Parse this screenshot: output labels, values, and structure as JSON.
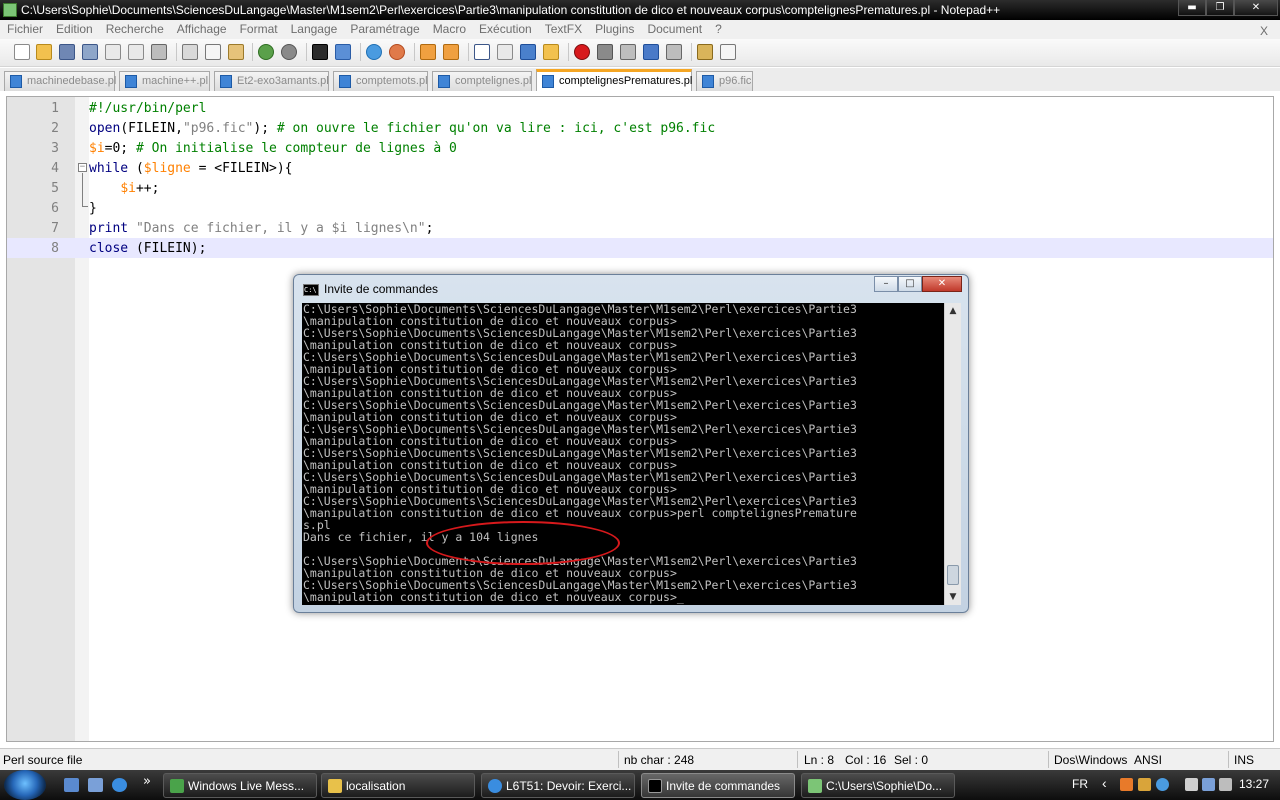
{
  "window": {
    "title": "C:\\Users\\Sophie\\Documents\\SciencesDuLangage\\Master\\M1sem2\\Perl\\exercices\\Partie3\\manipulation constitution de dico et nouveaux corpus\\comptelignesPrematures.pl - Notepad++",
    "minimize": "▬",
    "maximize": "❐",
    "close": "✕"
  },
  "menu": {
    "items": [
      "Fichier",
      "Edition",
      "Recherche",
      "Affichage",
      "Format",
      "Langage",
      "Paramétrage",
      "Macro",
      "Exécution",
      "TextFX",
      "Plugins",
      "Document",
      "?"
    ],
    "close": "X"
  },
  "tabs": [
    {
      "label": "machinedebase.pl"
    },
    {
      "label": "machine++.pl"
    },
    {
      "label": "Et2-exo3amants.pl"
    },
    {
      "label": "comptemots.pl"
    },
    {
      "label": "comptelignes.pl"
    },
    {
      "label": "comptelignesPrematures.pl",
      "active": true
    },
    {
      "label": "p96.fic"
    }
  ],
  "editor": {
    "line_numbers": [
      "1",
      "2",
      "3",
      "4",
      "5",
      "6",
      "7",
      "8"
    ],
    "code": {
      "l1": "#!/usr/bin/perl",
      "l2_fn": "open",
      "l2_args_pre": "(FILEIN,",
      "l2_str": "\"p96.fic\"",
      "l2_args_post": ");",
      "l2_comment": " # on ouvre le fichier qu'on va lire : ici, c'est p96.fic",
      "l3_var": "$i",
      "l3_rest": "=0;",
      "l3_comment": " # On initialise le compteur de lignes à 0",
      "l4_kw": "while",
      "l4_pre": " (",
      "l4_var": "$ligne",
      "l4_post": " = <FILEIN>){",
      "l5_indent": "    ",
      "l5_var": "$i",
      "l5_rest": "++;",
      "l6": "}",
      "l7_kw": "print",
      "l7_str": " \"Dans ce fichier, il y a $i lignes\\n\"",
      "l7_post": ";",
      "l8_kw": "close",
      "l8_rest": " (FILEIN);"
    },
    "fold_marker": "−"
  },
  "cmd": {
    "title": "Invite de commandes",
    "icon_text": "C:\\",
    "minimize": "–",
    "maximize": "□",
    "close": "✕",
    "scroll_up": "▲",
    "scroll_down": "▼",
    "lines": [
      "C:\\Users\\Sophie\\Documents\\SciencesDuLangage\\Master\\M1sem2\\Perl\\exercices\\Partie3",
      "\\manipulation constitution de dico et nouveaux corpus>",
      "C:\\Users\\Sophie\\Documents\\SciencesDuLangage\\Master\\M1sem2\\Perl\\exercices\\Partie3",
      "\\manipulation constitution de dico et nouveaux corpus>",
      "C:\\Users\\Sophie\\Documents\\SciencesDuLangage\\Master\\M1sem2\\Perl\\exercices\\Partie3",
      "\\manipulation constitution de dico et nouveaux corpus>",
      "C:\\Users\\Sophie\\Documents\\SciencesDuLangage\\Master\\M1sem2\\Perl\\exercices\\Partie3",
      "\\manipulation constitution de dico et nouveaux corpus>",
      "C:\\Users\\Sophie\\Documents\\SciencesDuLangage\\Master\\M1sem2\\Perl\\exercices\\Partie3",
      "\\manipulation constitution de dico et nouveaux corpus>",
      "C:\\Users\\Sophie\\Documents\\SciencesDuLangage\\Master\\M1sem2\\Perl\\exercices\\Partie3",
      "\\manipulation constitution de dico et nouveaux corpus>",
      "C:\\Users\\Sophie\\Documents\\SciencesDuLangage\\Master\\M1sem2\\Perl\\exercices\\Partie3",
      "\\manipulation constitution de dico et nouveaux corpus>",
      "C:\\Users\\Sophie\\Documents\\SciencesDuLangage\\Master\\M1sem2\\Perl\\exercices\\Partie3",
      "\\manipulation constitution de dico et nouveaux corpus>",
      "C:\\Users\\Sophie\\Documents\\SciencesDuLangage\\Master\\M1sem2\\Perl\\exercices\\Partie3",
      "\\manipulation constitution de dico et nouveaux corpus>perl comptelignesPremature",
      "s.pl",
      "Dans ce fichier, il y a 104 lignes",
      "",
      "C:\\Users\\Sophie\\Documents\\SciencesDuLangage\\Master\\M1sem2\\Perl\\exercices\\Partie3",
      "\\manipulation constitution de dico et nouveaux corpus>",
      "C:\\Users\\Sophie\\Documents\\SciencesDuLangage\\Master\\M1sem2\\Perl\\exercices\\Partie3",
      "\\manipulation constitution de dico et nouveaux corpus>_"
    ]
  },
  "status": {
    "file_type": "Perl source file",
    "nb_char": "nb char : 248",
    "ln": "Ln : 8",
    "col": "Col : 16",
    "sel": "Sel : 0",
    "eol": "Dos\\Windows",
    "encoding": "ANSI",
    "mode": "INS"
  },
  "taskbar": {
    "quicklaunch_more": "»",
    "tasks": [
      {
        "label": "Windows Live Mess..."
      },
      {
        "label": "localisation"
      },
      {
        "label": "L6T51: Devoir: Exerci..."
      },
      {
        "label": "Invite de commandes",
        "active": true
      },
      {
        "label": "C:\\Users\\Sophie\\Do..."
      }
    ],
    "lang": "FR",
    "tray_arrow": "‹",
    "clock": "13:27"
  },
  "colors": {
    "keyword": "#000080",
    "variable": "#ff8000",
    "string": "#808080",
    "comment": "#008000",
    "highlight_circle": "#d7191c"
  }
}
